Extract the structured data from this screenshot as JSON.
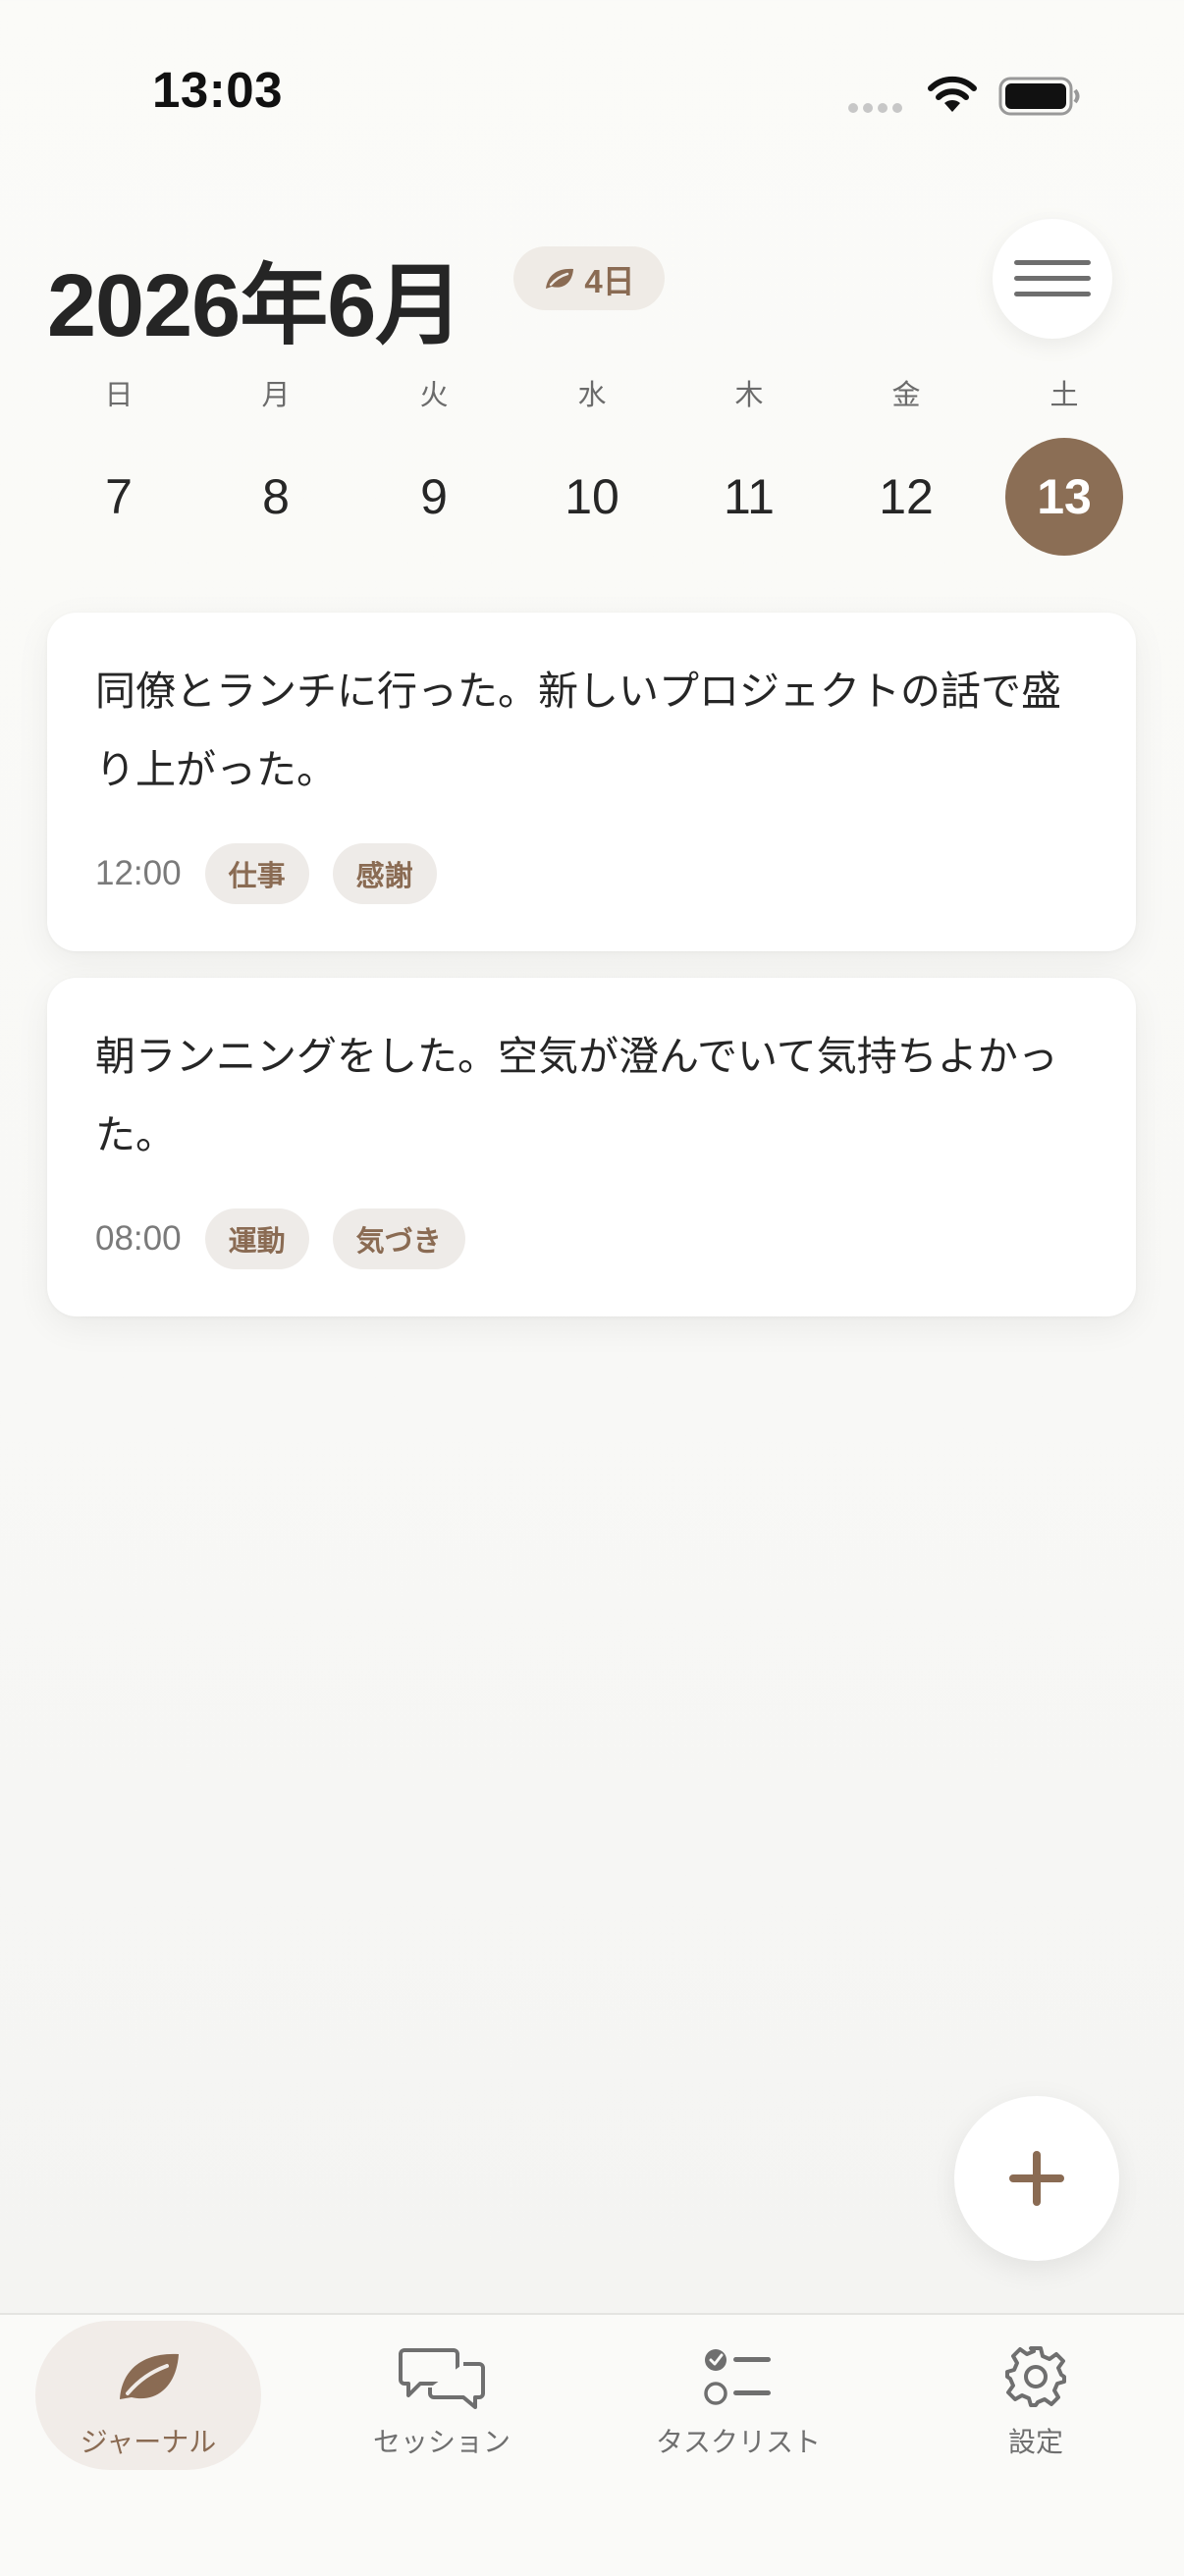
{
  "status_bar": {
    "time": "13:03"
  },
  "header": {
    "month_title": "2026年6月",
    "streak_badge": "4日"
  },
  "week": {
    "days": [
      {
        "label": "日",
        "date": "7",
        "selected": false
      },
      {
        "label": "月",
        "date": "8",
        "selected": false
      },
      {
        "label": "火",
        "date": "9",
        "selected": false
      },
      {
        "label": "水",
        "date": "10",
        "selected": false
      },
      {
        "label": "木",
        "date": "11",
        "selected": false
      },
      {
        "label": "金",
        "date": "12",
        "selected": false
      },
      {
        "label": "土",
        "date": "13",
        "selected": true
      }
    ]
  },
  "entries": [
    {
      "text": "同僚とランチに行った。新しいプロジェクトの話で盛り上がった。",
      "time": "12:00",
      "tags": [
        "仕事",
        "感謝"
      ]
    },
    {
      "text": "朝ランニングをした。空気が澄んでいて気持ちよかった。",
      "time": "08:00",
      "tags": [
        "運動",
        "気づき"
      ]
    }
  ],
  "tabs": [
    {
      "label": "ジャーナル",
      "icon": "leaf-icon",
      "active": true
    },
    {
      "label": "セッション",
      "icon": "chat-bubbles-icon",
      "active": false
    },
    {
      "label": "タスクリスト",
      "icon": "checklist-icon",
      "active": false
    },
    {
      "label": "設定",
      "icon": "gear-icon",
      "active": false
    }
  ],
  "colors": {
    "accent": "#8b6e55",
    "badge_bg": "#efebe6",
    "tag_bg": "#eeebe8",
    "background": "#f8f8f6"
  }
}
